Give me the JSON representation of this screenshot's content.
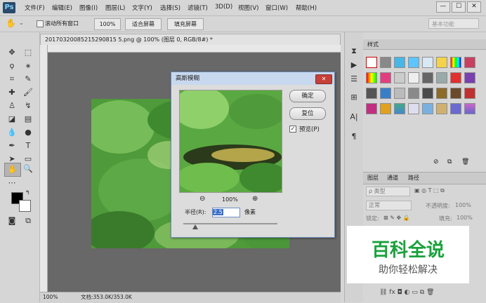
{
  "app": {
    "logo": "Ps"
  },
  "menu": [
    "文件(F)",
    "编辑(E)",
    "图像(I)",
    "图层(L)",
    "文字(Y)",
    "选择(S)",
    "滤镜(T)",
    "3D(D)",
    "视图(V)",
    "窗口(W)",
    "帮助(H)"
  ],
  "window_controls": {
    "minimize": "—",
    "restore": "☐",
    "close": "✕"
  },
  "options_bar": {
    "scroll_all_windows": "滚动所有窗口",
    "zoom_value": "100%",
    "fit_screen": "适合屏幕",
    "fill_screen": "填充屏幕",
    "workspace": "基本功能"
  },
  "document": {
    "tab_title": "20170320085215290815 5.png @ 100% (图层 0, RGB/8#) *",
    "status_zoom": "100%",
    "status_doc": "文档:353.0K/353.0K"
  },
  "dialog": {
    "title": "高斯模糊",
    "close": "✕",
    "ok": "确定",
    "reset": "复位",
    "preview_label": "预览(P)",
    "preview_checked": true,
    "zoom_percent": "100%",
    "radius_label": "半径(R):",
    "radius_value": "2.5",
    "radius_unit": "像素"
  },
  "styles_panel": {
    "tab": "样式"
  },
  "layers_panel": {
    "tabs": [
      "图层",
      "通道",
      "路径"
    ],
    "filter_kind": "ρ 类型",
    "blend_mode": "正常",
    "opacity_label": "不透明度:",
    "opacity_value": "100%",
    "lock_label": "锁定:",
    "fill_label": "填充:",
    "fill_value": "100%"
  },
  "watermark": {
    "title": "百科全说",
    "subtitle": "助你轻松解决"
  },
  "colors": {
    "foreground": "#000000",
    "background": "#ffffff",
    "dialog_title": "#c8d8ee",
    "close_red": "#c6403a",
    "watermark_green": "#1aa13c"
  }
}
